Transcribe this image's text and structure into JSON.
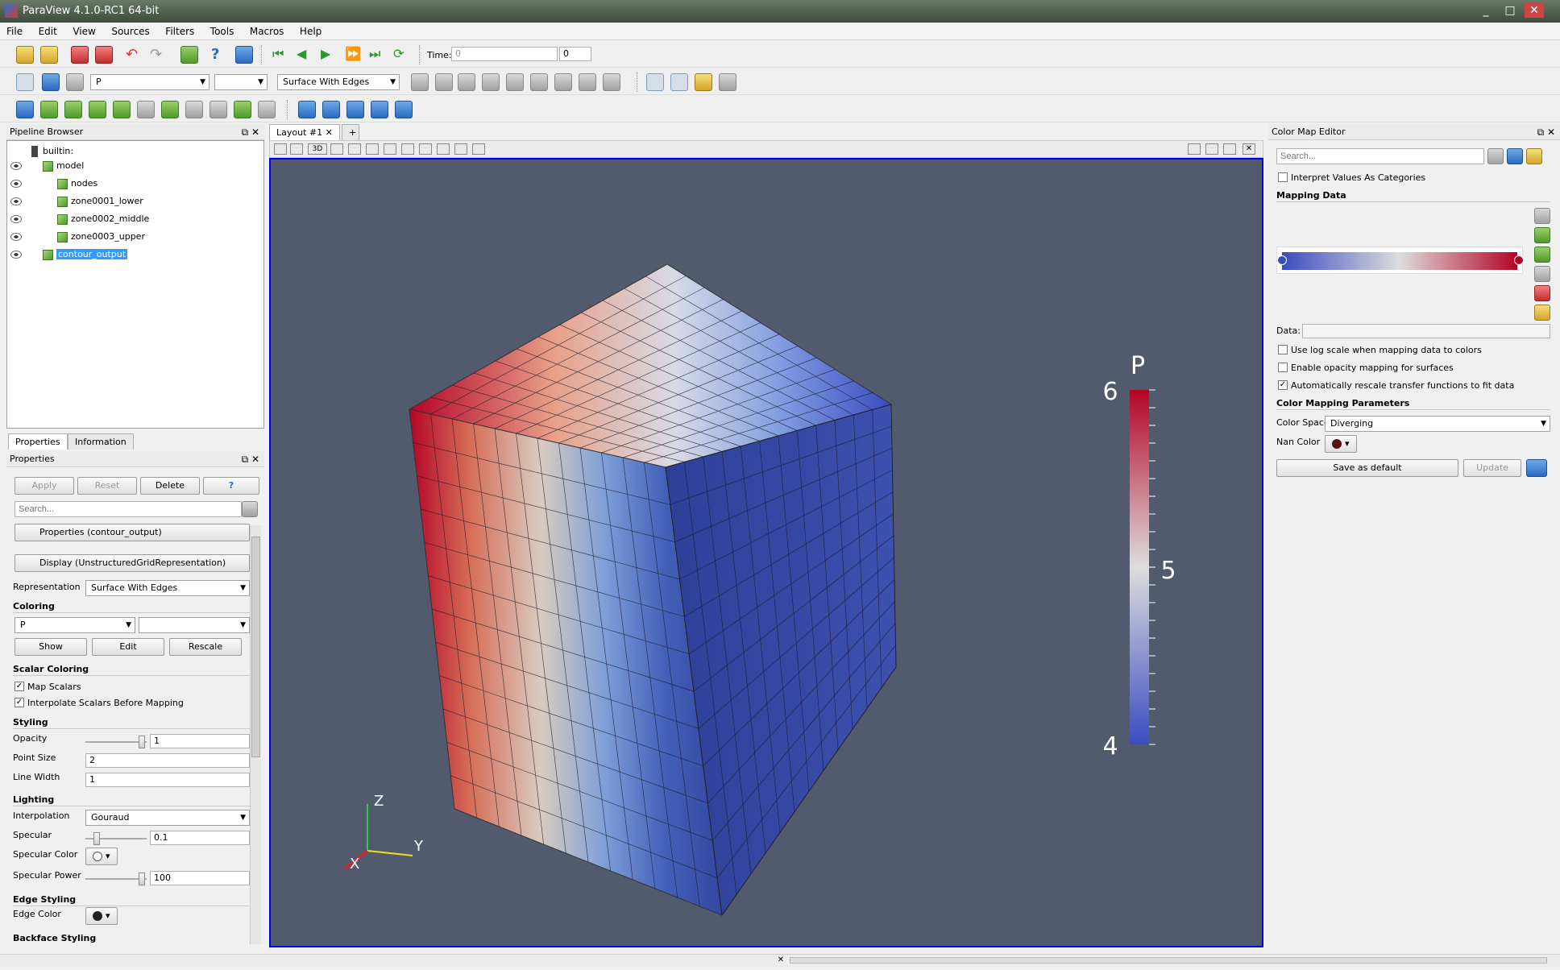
{
  "window": {
    "title": "ParaView 4.1.0-RC1 64-bit",
    "controls": [
      "_",
      "□",
      "✕"
    ]
  },
  "menu": [
    "File",
    "Edit",
    "View",
    "Sources",
    "Filters",
    "Tools",
    "Macros",
    "Help"
  ],
  "toolbar1": {
    "time_label": "Time:",
    "time_value": "0",
    "time_index": "0"
  },
  "toolbar2": {
    "variable": "P",
    "component": "",
    "representation": "Surface With Edges"
  },
  "pipeline": {
    "title": "Pipeline Browser",
    "items": [
      {
        "label": "builtin:"
      },
      {
        "label": "model"
      },
      {
        "label": "nodes"
      },
      {
        "label": "zone0001_lower"
      },
      {
        "label": "zone0002_middle"
      },
      {
        "label": "zone0003_upper"
      },
      {
        "label": "contour_output"
      }
    ]
  },
  "tabs": {
    "properties": "Properties",
    "information": "Information"
  },
  "properties": {
    "title": "Properties",
    "apply": "Apply",
    "reset": "Reset",
    "delete": "Delete",
    "help": "?",
    "search_placeholder": "Search...",
    "section_props": "Properties (contour_output)",
    "section_display": "Display (UnstructuredGridRepresentation)",
    "representation_label": "Representation",
    "representation_value": "Surface With Edges",
    "coloring_header": "Coloring",
    "coloring_var": "P",
    "coloring_comp": "",
    "show": "Show",
    "edit": "Edit",
    "rescale": "Rescale",
    "scalar_header": "Scalar Coloring",
    "map_scalars": "Map Scalars",
    "interp_scalars": "Interpolate Scalars Before Mapping",
    "styling_header": "Styling",
    "opacity_label": "Opacity",
    "opacity_value": "1",
    "point_size_label": "Point Size",
    "point_size_value": "2",
    "line_width_label": "Line Width",
    "line_width_value": "1",
    "lighting_header": "Lighting",
    "interp_label": "Interpolation",
    "interp_value": "Gouraud",
    "specular_label": "Specular",
    "specular_value": "0.1",
    "spec_color_label": "Specular Color",
    "spec_power_label": "Specular Power",
    "spec_power_value": "100",
    "edge_header": "Edge Styling",
    "edge_color_label": "Edge Color",
    "backface_header": "Backface Styling"
  },
  "layout": {
    "tab": "Layout #1",
    "add": "+",
    "mode3d": "3D"
  },
  "scalarbar": {
    "title": "P",
    "max": "6",
    "mid": "5",
    "min": "4"
  },
  "axes": {
    "x": "X",
    "y": "Y",
    "z": "Z"
  },
  "cmap": {
    "title": "Color Map Editor",
    "search_placeholder": "Search...",
    "interpret": "Interpret Values As Categories",
    "mapping_header": "Mapping Data",
    "data_label": "Data:",
    "log_scale": "Use log scale when mapping data to colors",
    "opacity_map": "Enable opacity mapping for surfaces",
    "auto_rescale": "Automatically rescale transfer functions to fit data",
    "params_header": "Color Mapping Parameters",
    "color_space_label": "Color Space",
    "color_space_value": "Diverging",
    "nan_label": "Nan Color",
    "save_default": "Save as default",
    "update": "Update"
  },
  "colors": {
    "cold": "#3b4cc0",
    "warm": "#b40426",
    "mid": "#dddddd",
    "bg": "#525a6e"
  }
}
